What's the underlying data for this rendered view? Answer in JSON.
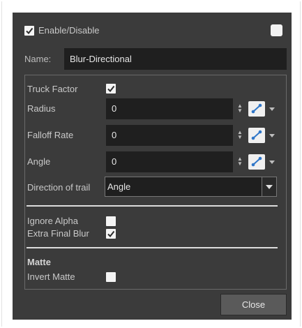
{
  "header": {
    "enable_label": "Enable/Disable",
    "enable_checked": true
  },
  "name": {
    "label": "Name:",
    "value": "Blur-Directional"
  },
  "props": {
    "truck_factor": {
      "label": "Truck Factor",
      "checked": true
    },
    "radius": {
      "label": "Radius",
      "value": "0"
    },
    "falloff": {
      "label": "Falloff Rate",
      "value": "0"
    },
    "angle": {
      "label": "Angle",
      "value": "0"
    },
    "direction": {
      "label": "Direction of trail",
      "value": "Angle"
    },
    "ignore_alpha": {
      "label": "Ignore Alpha",
      "checked": false
    },
    "extra_final_blur": {
      "label": "Extra Final Blur",
      "checked": true
    }
  },
  "matte": {
    "heading": "Matte",
    "invert_label": "Invert Matte",
    "invert_checked": false
  },
  "footer": {
    "close_label": "Close"
  }
}
